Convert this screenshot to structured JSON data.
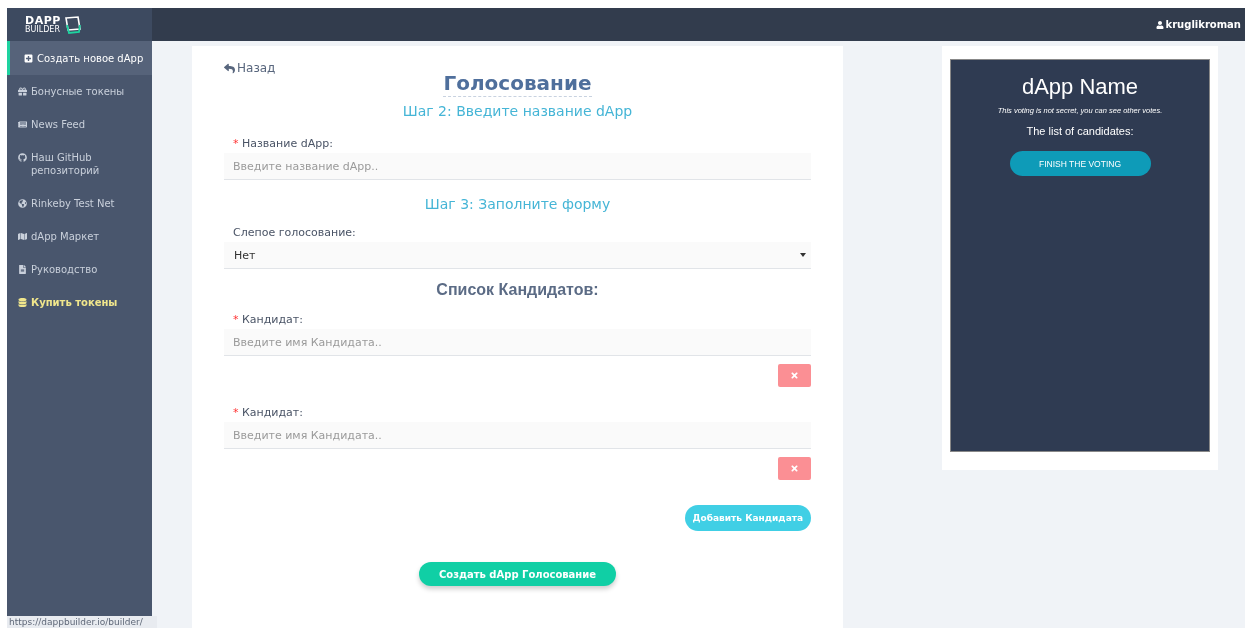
{
  "logo": {
    "title": "DAPP",
    "subtitle": "BUILDER"
  },
  "top_bar": {
    "user": "kruglikroman"
  },
  "sidebar": {
    "items": [
      {
        "label": "Создать новое dApp",
        "selected": true,
        "highlight": false
      },
      {
        "label": "Бонусные токены",
        "selected": false,
        "highlight": false
      },
      {
        "label": "News Feed",
        "selected": false,
        "highlight": false
      },
      {
        "label": "Наш GitHub репозиторий",
        "selected": false,
        "highlight": false
      },
      {
        "label": "Rinkeby Test Net",
        "selected": false,
        "highlight": false
      },
      {
        "label": "dApp Маркет",
        "selected": false,
        "highlight": false
      },
      {
        "label": "Руководство",
        "selected": false,
        "highlight": false
      },
      {
        "label": "Купить токены",
        "selected": false,
        "highlight": true
      }
    ]
  },
  "status_url": "https://dappbuilder.io/builder/",
  "form": {
    "back": "Назад",
    "title": "Голосование",
    "step2": "Шаг 2: Введите название dApp",
    "name_field": {
      "mark": "*",
      "label": "Название dApp:",
      "placeholder": "Введите название dApp.."
    },
    "step3": "Шаг 3: Заполните форму",
    "blind_field": {
      "label": "Слепое голосование:",
      "value": "Нет"
    },
    "candidates_title": "Список Кандидатов:",
    "candidates": [
      {
        "mark": "*",
        "label": "Кандидат:",
        "placeholder": "Введите имя Кандидата.."
      },
      {
        "mark": "*",
        "label": "Кандидат:",
        "placeholder": "Введите имя Кандидата.."
      }
    ],
    "add_button": "Добавить Кандидата",
    "submit_button": "Создать dApp Голосование"
  },
  "preview": {
    "title": "dApp Name",
    "note": "This voting is not secret, you can see other votes.",
    "list_title": "The list of candidates:",
    "button": "FINISH THE VOTING"
  }
}
